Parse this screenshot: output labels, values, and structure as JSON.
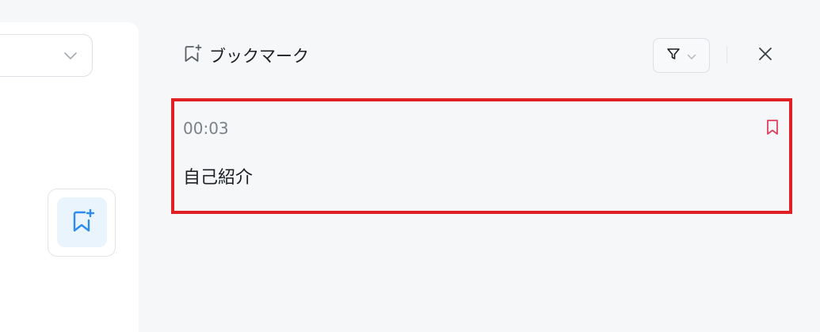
{
  "panel": {
    "title": "ブックマーク"
  },
  "icons": {
    "header": "bookmark-add-icon",
    "filter": "filter-icon",
    "filter_dropdown": "chevron-down-icon",
    "close": "close-icon",
    "item_bookmark": "bookmark-icon",
    "left_dropdown": "chevron-down-icon",
    "left_button": "bookmark-add-icon"
  },
  "bookmarks": [
    {
      "time": "00:03",
      "text": "自己紹介"
    }
  ],
  "colors": {
    "highlight": "#e02024",
    "bookmark_marker": "#e0405e",
    "accent_blue": "#2d8cf0"
  }
}
